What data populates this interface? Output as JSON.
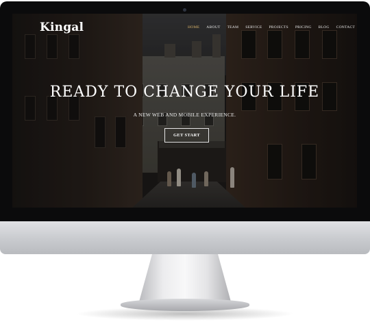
{
  "site": {
    "logo": "Kingal",
    "nav": [
      {
        "label": "HOME",
        "active": true
      },
      {
        "label": "ABOUT",
        "active": false
      },
      {
        "label": "TEAM",
        "active": false
      },
      {
        "label": "SERVICE",
        "active": false
      },
      {
        "label": "PROJECTS",
        "active": false
      },
      {
        "label": "PRICING",
        "active": false
      },
      {
        "label": "BLOG",
        "active": false
      },
      {
        "label": "CONTACT",
        "active": false
      }
    ],
    "nav_active_color": "#d9b36a"
  },
  "hero": {
    "title": "READY TO CHANGE YOUR LIFE",
    "subtitle": "A NEW WEB AND MOBILE EXPERIENCE.",
    "cta_label": "GET START"
  }
}
